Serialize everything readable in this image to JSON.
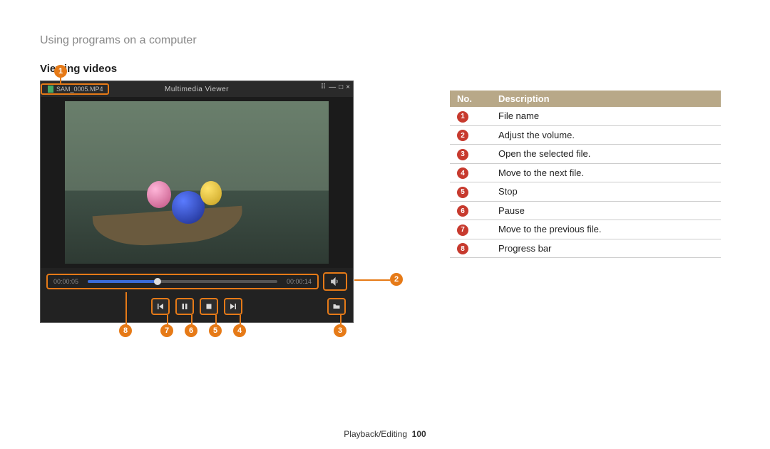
{
  "header": "Using programs on a computer",
  "section_title": "Viewing videos",
  "player": {
    "file_name": "SAM_0005.MP4",
    "window_title": "Multimedia Viewer",
    "time_elapsed": "00:00:05",
    "time_total": "00:00:14"
  },
  "callouts": [
    "1",
    "2",
    "3",
    "4",
    "5",
    "6",
    "7",
    "8"
  ],
  "table": {
    "headers": {
      "no": "No.",
      "desc": "Description"
    },
    "rows": [
      {
        "n": "1",
        "d": "File name"
      },
      {
        "n": "2",
        "d": "Adjust the volume."
      },
      {
        "n": "3",
        "d": "Open the selected file."
      },
      {
        "n": "4",
        "d": "Move to the next file."
      },
      {
        "n": "5",
        "d": "Stop"
      },
      {
        "n": "6",
        "d": "Pause"
      },
      {
        "n": "7",
        "d": "Move to the previous file."
      },
      {
        "n": "8",
        "d": "Progress bar"
      }
    ]
  },
  "footer": {
    "section": "Playback/Editing",
    "page": "100"
  }
}
